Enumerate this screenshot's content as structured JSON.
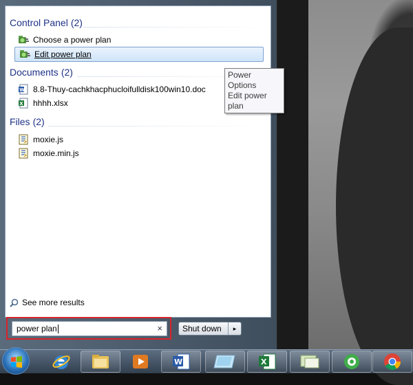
{
  "search_results": {
    "groups": [
      {
        "title": "Control Panel",
        "count": "(2)",
        "items": [
          {
            "label": "Choose a power plan",
            "icon": "power-options-icon",
            "selected": false
          },
          {
            "label": "Edit power plan",
            "icon": "power-options-icon",
            "selected": true
          }
        ]
      },
      {
        "title": "Documents",
        "count": "(2)",
        "items": [
          {
            "label": "8.8-Thuy-cachkhacphucloifulldisk100win10.doc",
            "icon": "word-document-icon"
          },
          {
            "label": "hhhh.xlsx",
            "icon": "excel-document-icon"
          }
        ]
      },
      {
        "title": "Files",
        "count": "(2)",
        "items": [
          {
            "label": "moxie.js",
            "icon": "script-file-icon"
          },
          {
            "label": "moxie.min.js",
            "icon": "script-file-icon"
          }
        ]
      }
    ],
    "see_more": "See more results"
  },
  "tooltip": {
    "line1": "Power Options",
    "line2": "Edit power plan"
  },
  "search": {
    "value": "power plan",
    "clear_glyph": "×"
  },
  "shutdown": {
    "label": "Shut down",
    "arrow": "▸"
  },
  "taskbar": {
    "items": [
      "start-orb",
      "internet-explorer-icon",
      "windows-explorer-icon",
      "media-player-icon",
      "microsoft-word-icon",
      "aero-window-icon",
      "microsoft-excel-icon",
      "app-window-icon",
      "greenshot-icon",
      "google-chrome-icon"
    ]
  },
  "colors": {
    "group_title": "#1e3287",
    "highlight_border": "#d9242a",
    "selection": "#cfe4fa"
  }
}
